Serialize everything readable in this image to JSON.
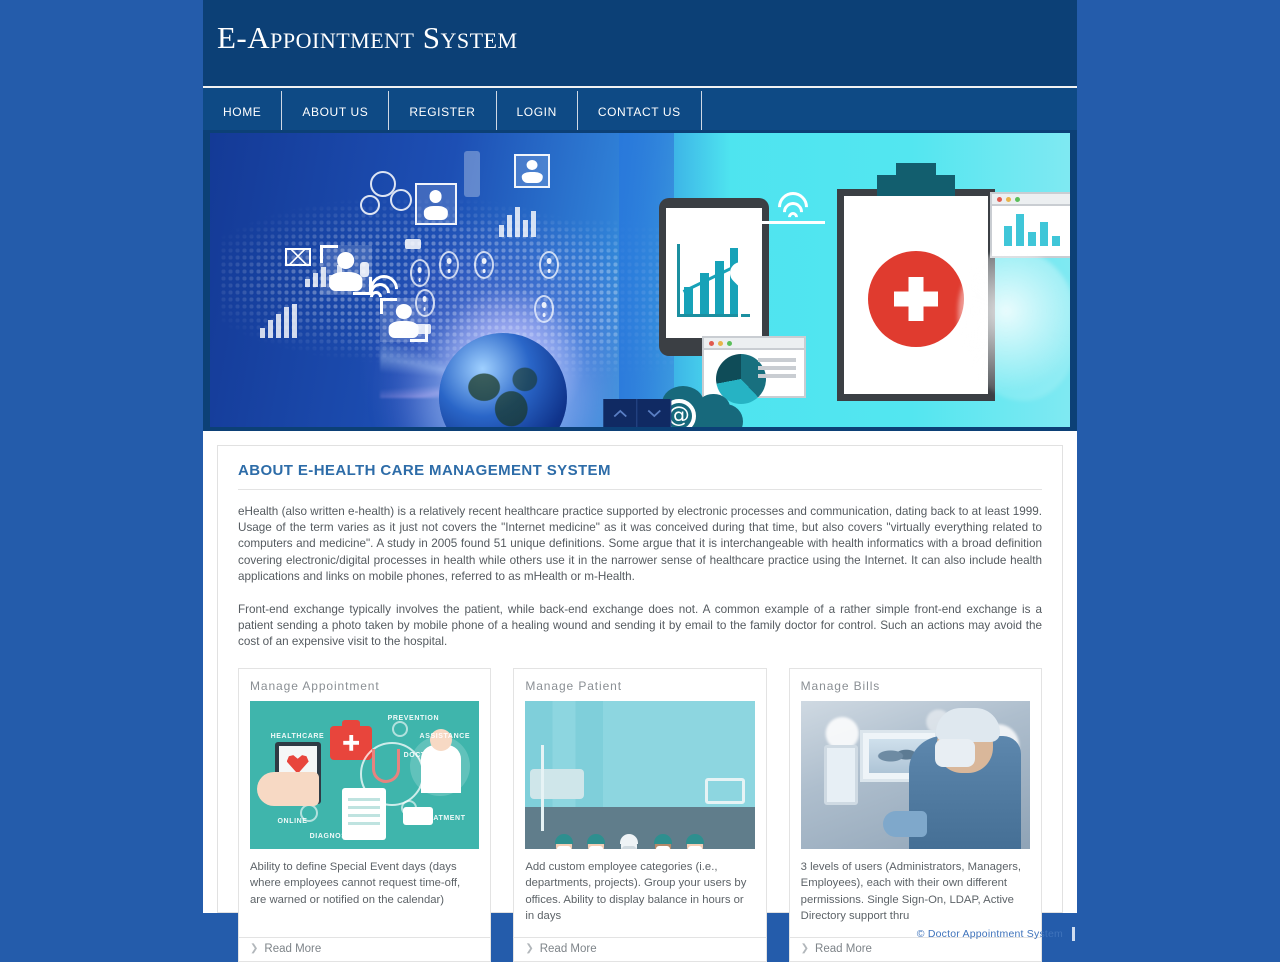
{
  "site": {
    "title": "E-Appointment System"
  },
  "nav": {
    "items": [
      {
        "label": "Home",
        "name": "nav-home"
      },
      {
        "label": "About Us",
        "name": "nav-about-us"
      },
      {
        "label": "Register",
        "name": "nav-register"
      },
      {
        "label": "Login",
        "name": "nav-login"
      },
      {
        "label": "Contact Us",
        "name": "nav-contact-us"
      }
    ]
  },
  "banner": {
    "alt": "e-health digital network banner with globe, medical clipboard and charts",
    "controls": {
      "prev": "prev-slide",
      "next": "next-slide"
    }
  },
  "about": {
    "heading": "About E-Health Care Management System",
    "paragraphs": [
      "eHealth (also written e-health) is a relatively recent healthcare practice supported by electronic processes and communication, dating back to at least 1999. Usage of the term varies as it just not covers the \"Internet medicine\" as it was conceived during that time, but also covers \"virtually everything related to computers and medicine\". A study in 2005 found 51 unique definitions. Some argue that it is interchangeable with health informatics with a broad definition covering electronic/digital processes in health while others use it in the narrower sense of healthcare practice using the Internet. It can also include health applications and links on mobile phones, referred to as mHealth or m-Health.",
      "Front-end exchange typically involves the patient, while back-end exchange does not. A common example of a rather simple front-end exchange is a patient sending a photo taken by mobile phone of a healing wound and sending it by email to the family doctor for control. Such an actions may avoid the cost of an expensive visit to the hospital."
    ]
  },
  "cards": [
    {
      "title": "Manage Appointment",
      "text": "Ability to define Special Event days (days where employees cannot request time-off, are warned or notified on the calendar)",
      "read_more": "Read More",
      "media_alt": "teal healthcare infographic with tablet, first aid kit, stethoscope and doctor"
    },
    {
      "title": "Manage Patient",
      "text": "Add custom employee categories (i.e., departments, projects). Group your users by offices. Ability to display balance in hours or in days",
      "read_more": "Read More",
      "media_alt": "illustration of five medical workers in scrubs and lab coats"
    },
    {
      "title": "Manage Bills",
      "text": "3 levels of users (Administrators, Managers, Employees), each with their own different permissions. Single Sign-On, LDAP, Active Directory support thru",
      "read_more": "Read More",
      "media_alt": "photo of a surgeon operating a medical imaging monitor"
    }
  ],
  "footer": {
    "copyright": "© Doctor Appointment System"
  },
  "colors": {
    "page_background": "#245cab",
    "masthead": "#0c4076",
    "navbar": "#0e4a85",
    "heading": "#2d6ca8",
    "body_text": "#555b60",
    "card_border": "#e3e3e3",
    "footer_text": "#3f73bb"
  },
  "icons": {
    "chevron_up": "chevron-up-icon",
    "chevron_down": "chevron-down-icon",
    "read_more_chevron": "chevron-right-icon"
  }
}
